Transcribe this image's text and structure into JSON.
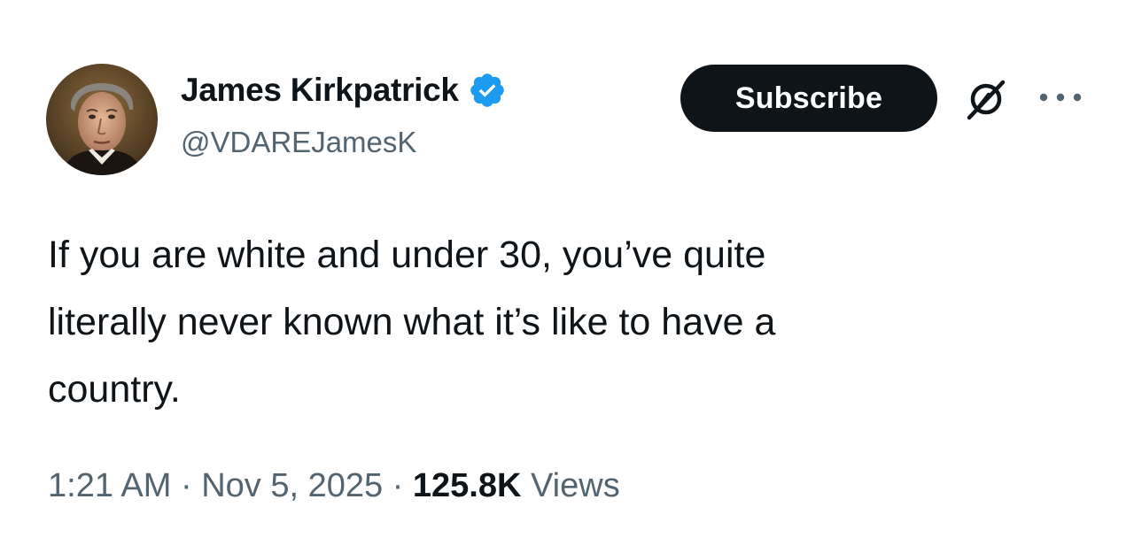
{
  "tweet": {
    "author": {
      "display_name": "James Kirkpatrick",
      "handle": "@VDAREJamesK",
      "verified": true,
      "avatar_icon": "portrait-avatar"
    },
    "actions": {
      "subscribe_label": "Subscribe",
      "grok_icon": "grok-slash-icon",
      "more_icon": "more-dots-icon"
    },
    "text_lines": [
      "If you are white and under 30, you’ve quite",
      "literally never known what it’s like to have a",
      "country."
    ],
    "meta": {
      "time": "1:21 AM",
      "separator": " · ",
      "date": "Nov 5, 2025",
      "views_count": "125.8K",
      "views_label": "Views"
    }
  },
  "colors": {
    "text_primary": "#0f1419",
    "text_secondary": "#536471",
    "verified_blue": "#1d9bf0",
    "button_bg": "#0f1419"
  }
}
